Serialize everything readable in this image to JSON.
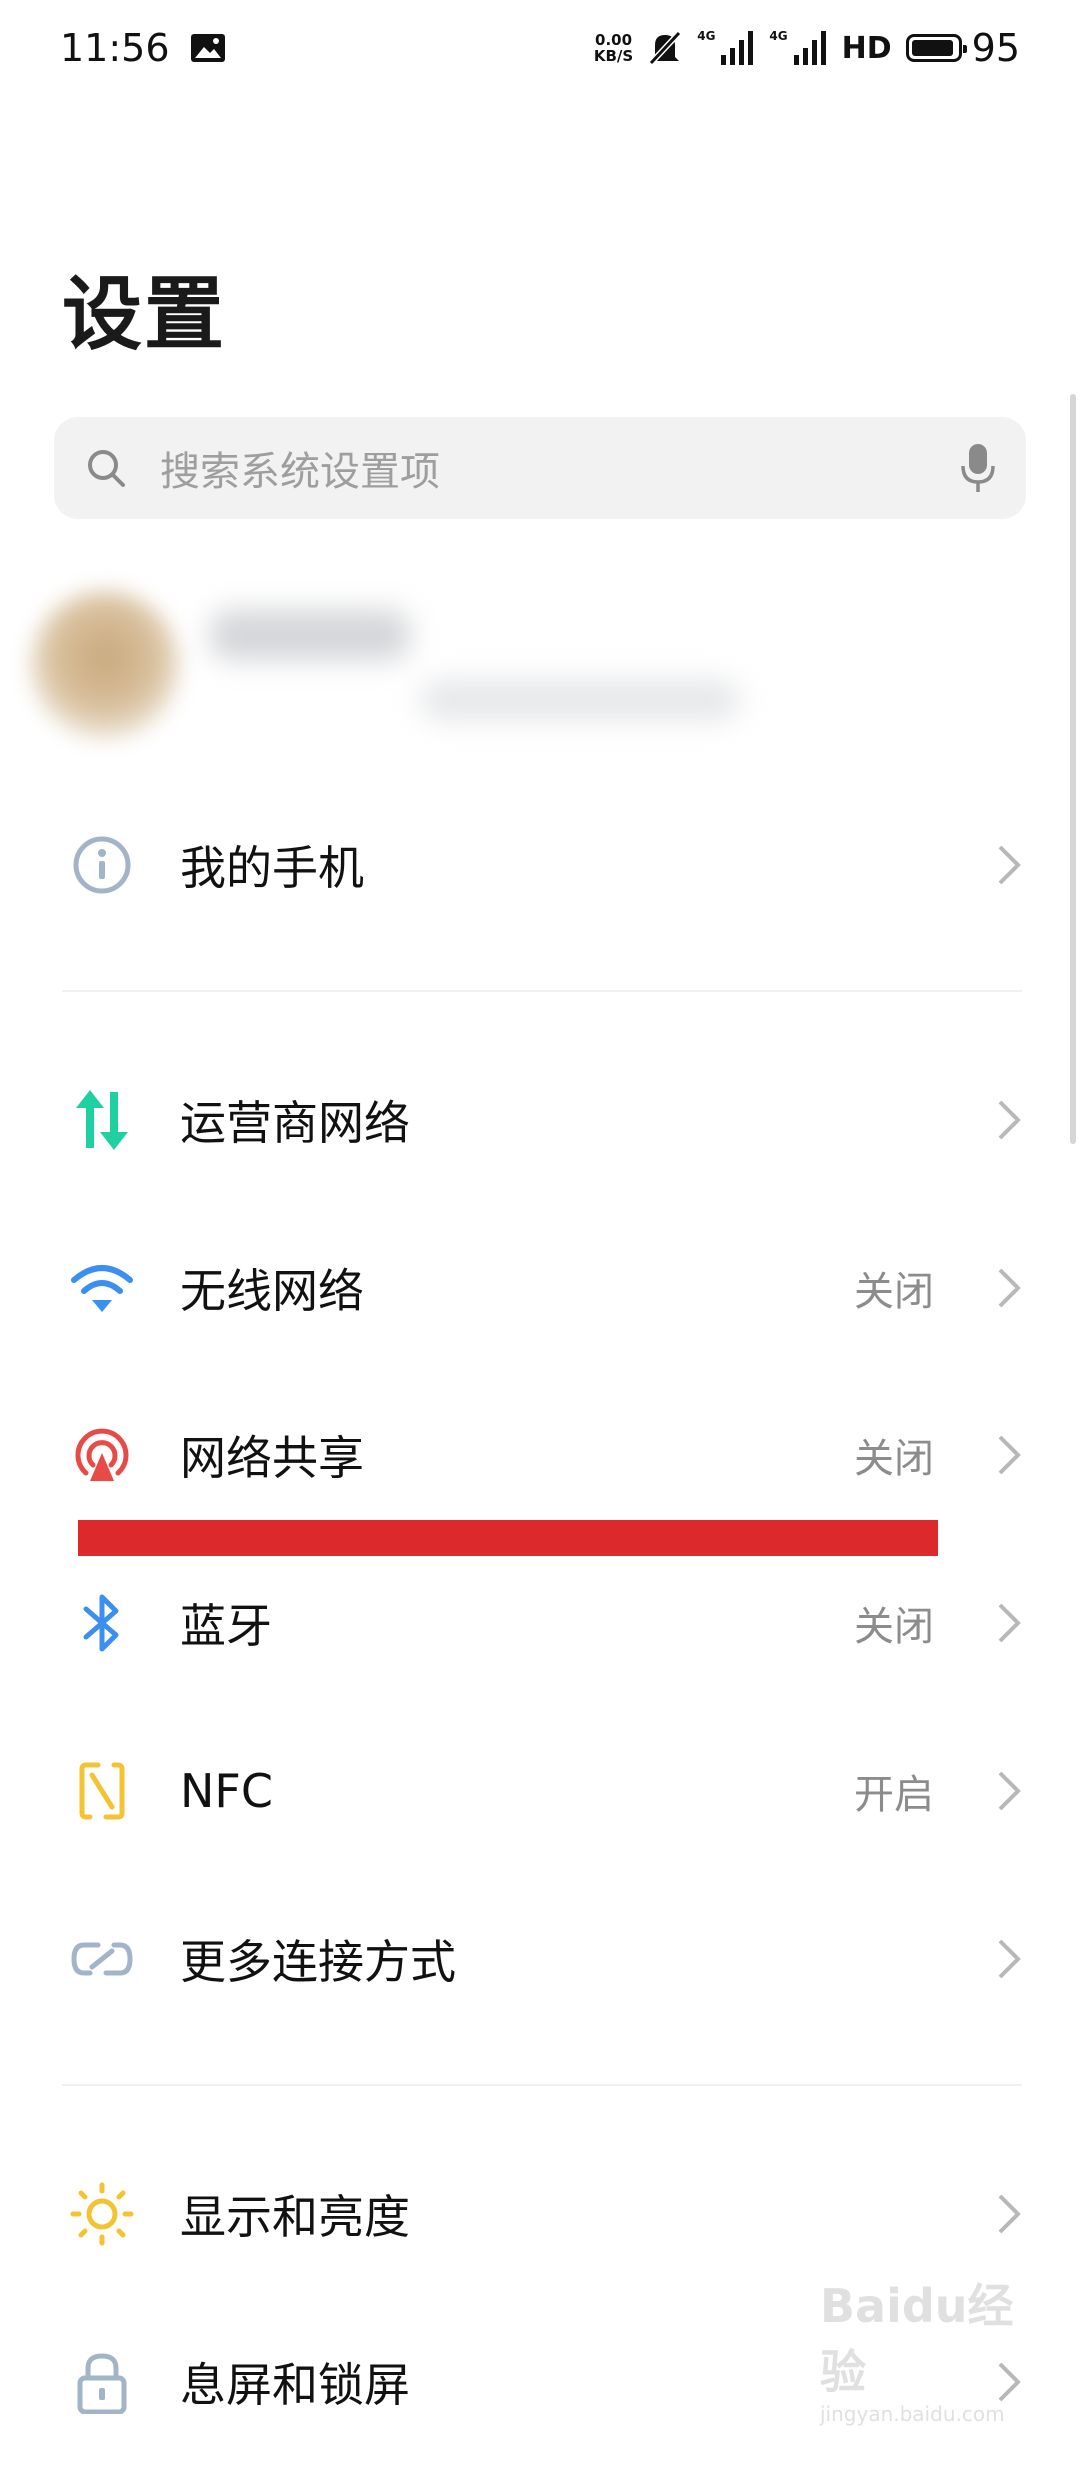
{
  "status_bar": {
    "time": "11:56",
    "net_speed_value": "0.00",
    "net_speed_unit": "KB/S",
    "signal1_label": "4G",
    "signal2_label": "4G",
    "hd_label": "HD",
    "battery_level": "95"
  },
  "page": {
    "title": "设置"
  },
  "search": {
    "placeholder": "搜索系统设置项"
  },
  "items": [
    {
      "label": "我的手机",
      "value": "",
      "icon": "info-icon"
    },
    {
      "label": "运营商网络",
      "value": "",
      "icon": "mobile-data-icon"
    },
    {
      "label": "无线网络",
      "value": "关闭",
      "icon": "wifi-icon"
    },
    {
      "label": "网络共享",
      "value": "关闭",
      "icon": "hotspot-icon"
    },
    {
      "label": "蓝牙",
      "value": "关闭",
      "icon": "bluetooth-icon"
    },
    {
      "label": "NFC",
      "value": "开启",
      "icon": "nfc-icon"
    },
    {
      "label": "更多连接方式",
      "value": "",
      "icon": "link-icon"
    },
    {
      "label": "显示和亮度",
      "value": "",
      "icon": "brightness-icon"
    },
    {
      "label": "息屏和锁屏",
      "value": "",
      "icon": "lock-icon"
    }
  ],
  "watermark": {
    "main": "Baidu经验",
    "sub": "jingyan.baidu.com"
  },
  "colors": {
    "accent_green": "#1fd1a0",
    "accent_blue": "#3b8ff0",
    "accent_red": "#e84b45",
    "accent_yellow": "#f5c232",
    "icon_gray": "#a3b3c8",
    "annotation_red": "#dc2a2c"
  }
}
